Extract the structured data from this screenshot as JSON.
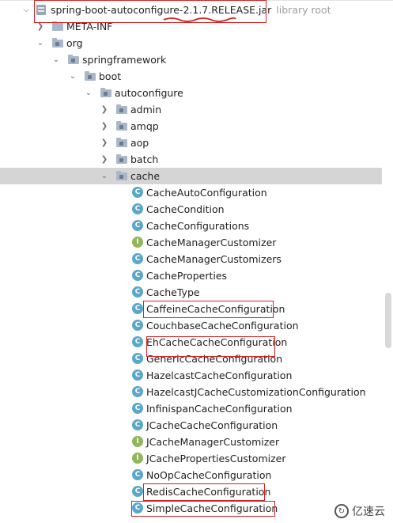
{
  "tree": {
    "jar": {
      "name": "spring-boot-autoconfigure-2.1.7.RELEASE.jar",
      "note": "library root"
    },
    "meta_inf": "META-INF",
    "org": "org",
    "springframework": "springframework",
    "boot": "boot",
    "autoconfigure": "autoconfigure",
    "packages": [
      "admin",
      "amqp",
      "aop",
      "batch"
    ],
    "cache": "cache",
    "classes": [
      {
        "name": "CacheAutoConfiguration",
        "kind": "C"
      },
      {
        "name": "CacheCondition",
        "kind": "C"
      },
      {
        "name": "CacheConfigurations",
        "kind": "C"
      },
      {
        "name": "CacheManagerCustomizer",
        "kind": "I"
      },
      {
        "name": "CacheManagerCustomizers",
        "kind": "C"
      },
      {
        "name": "CacheProperties",
        "kind": "C"
      },
      {
        "name": "CacheType",
        "kind": "C"
      },
      {
        "name": "CaffeineCacheConfiguration",
        "kind": "C"
      },
      {
        "name": "CouchbaseCacheConfiguration",
        "kind": "C"
      },
      {
        "name": "EhCacheCacheConfiguration",
        "kind": "C"
      },
      {
        "name": "GenericCacheConfiguration",
        "kind": "C"
      },
      {
        "name": "HazelcastCacheConfiguration",
        "kind": "C"
      },
      {
        "name": "HazelcastJCacheCustomizationConfiguration",
        "kind": "C"
      },
      {
        "name": "InfinispanCacheConfiguration",
        "kind": "C"
      },
      {
        "name": "JCacheCacheConfiguration",
        "kind": "C"
      },
      {
        "name": "JCacheManagerCustomizer",
        "kind": "I"
      },
      {
        "name": "JCachePropertiesCustomizer",
        "kind": "I"
      },
      {
        "name": "NoOpCacheConfiguration",
        "kind": "C"
      },
      {
        "name": "RedisCacheConfiguration",
        "kind": "C"
      },
      {
        "name": "SimpleCacheConfiguration",
        "kind": "C"
      }
    ]
  },
  "watermark": "亿速云",
  "colors": {
    "selection": "#d5d5d5",
    "highlight_box": "#d42323",
    "class_icon": "#5ba6c9",
    "interface_icon": "#8fb75b"
  }
}
